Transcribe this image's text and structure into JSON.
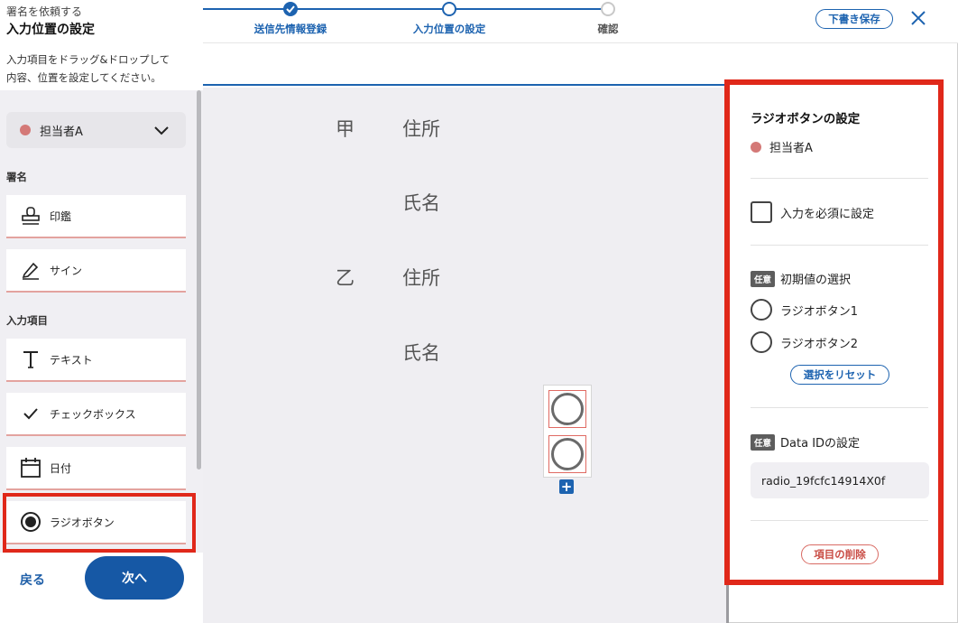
{
  "sidebar": {
    "breadcrumb": "署名を依頼する",
    "title": "入力位置の設定",
    "description_lines": [
      "入力項目をドラッグ&ドロップして",
      "内容、位置を設定してください。"
    ],
    "assignee": "担当者A",
    "signature_section": "署名",
    "signature_tools": [
      {
        "label": "印鑑",
        "icon": "stamp-icon"
      },
      {
        "label": "サイン",
        "icon": "pen-icon"
      }
    ],
    "input_section": "入力項目",
    "input_tools": [
      {
        "label": "テキスト",
        "icon": "text-icon"
      },
      {
        "label": "チェックボックス",
        "icon": "check-icon"
      },
      {
        "label": "日付",
        "icon": "calendar-icon"
      },
      {
        "label": "ラジオボタン",
        "icon": "radio-icon"
      }
    ],
    "back_label": "戻る",
    "next_label": "次へ"
  },
  "stepper": {
    "steps": [
      {
        "label": "送信先情報登録",
        "state": "done"
      },
      {
        "label": "入力位置の設定",
        "state": "current"
      },
      {
        "label": "確認",
        "state": "todo"
      }
    ]
  },
  "header": {
    "draft_label": "下書き保存",
    "close_icon": "close-icon"
  },
  "document": {
    "party_a": "甲",
    "party_b": "乙",
    "address": "住所",
    "name": "氏名"
  },
  "panel": {
    "title": "ラジオボタンの設定",
    "assignee": "担当者A",
    "required_label": "入力を必須に設定",
    "optional_badge": "任意",
    "default_heading": "初期値の選択",
    "options": [
      "ラジオボタン1",
      "ラジオボタン2"
    ],
    "reset_label": "選択をリセット",
    "dataid_heading": "Data IDの設定",
    "dataid_value": "radio_19fcfc14914X0f",
    "delete_label": "項目の削除"
  },
  "colors": {
    "accent": "#1d63b0",
    "assignee_dot": "#d47977",
    "highlight": "#e0281a"
  }
}
